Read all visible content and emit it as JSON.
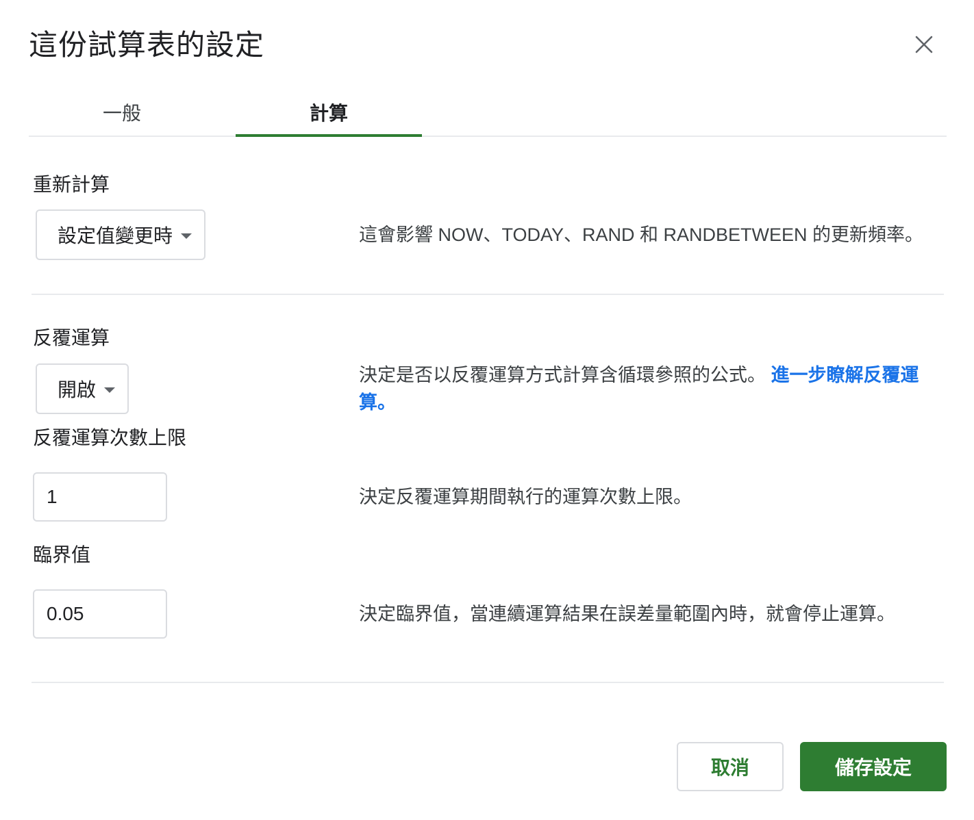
{
  "dialog": {
    "title": "這份試算表的設定",
    "close_icon": "close-icon"
  },
  "tabs": [
    {
      "label": "一般",
      "selected": false
    },
    {
      "label": "計算",
      "selected": true
    }
  ],
  "recalc": {
    "label": "重新計算",
    "value": "設定值變更時",
    "description": "這會影響 NOW、TODAY、RAND 和 RANDBETWEEN 的更新頻率。"
  },
  "iterative": {
    "label": "反覆運算",
    "value": "開啟",
    "description": "決定是否以反覆運算方式計算含循環參照的公式。",
    "link_text": "進一步瞭解反覆運算。"
  },
  "max_iterations": {
    "label": "反覆運算次數上限",
    "value": "1",
    "description": "決定反覆運算期間執行的運算次數上限。"
  },
  "threshold": {
    "label": "臨界值",
    "value": "0.05",
    "description": "決定臨界值，當連續運算結果在誤差量範圍內時，就會停止運算。"
  },
  "footer": {
    "cancel_label": "取消",
    "save_label": "儲存設定"
  },
  "colors": {
    "accent": "#2e7d32",
    "link": "#1a73e8"
  }
}
